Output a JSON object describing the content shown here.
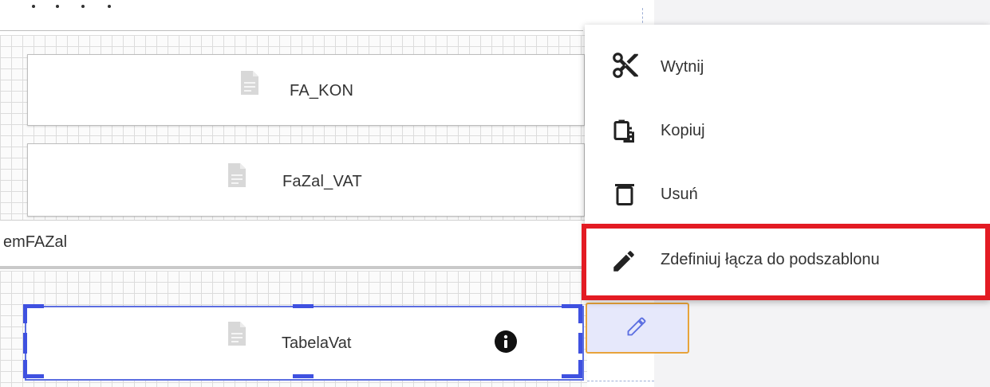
{
  "subreports": [
    {
      "name": "FA_KON"
    },
    {
      "name": "FaZal_VAT"
    },
    {
      "name": "TabelaVat"
    }
  ],
  "band": {
    "label": "emFAZal"
  },
  "context_menu": {
    "items": [
      {
        "label": "Wytnij",
        "icon": "scissors-icon"
      },
      {
        "label": "Kopiuj",
        "icon": "copy-icon"
      },
      {
        "label": "Usuń",
        "icon": "trash-icon"
      },
      {
        "label": "Zdefiniuj łącza do podszablonu",
        "icon": "pencil-icon"
      }
    ]
  },
  "colors": {
    "selection": "#3f51e0",
    "highlight": "#e31b23",
    "edit_button_border": "#e7a33b",
    "edit_button_bg": "#e6e8fb"
  }
}
